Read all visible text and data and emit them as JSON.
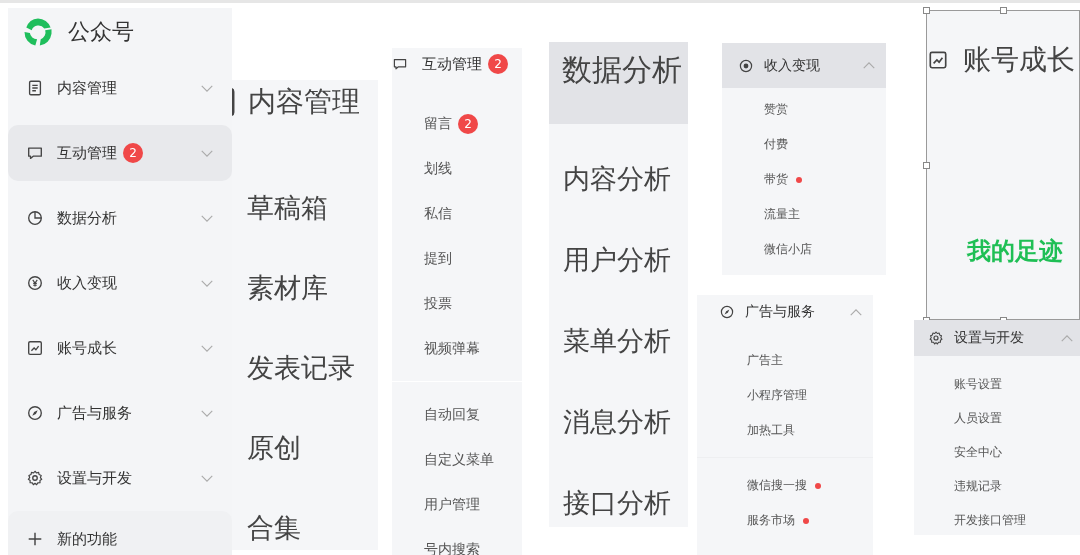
{
  "sidebar": {
    "logo": "公众号",
    "items": [
      {
        "label": "内容管理",
        "selected": false,
        "expanded": false
      },
      {
        "label": "互动管理",
        "badge": "2",
        "selected": true,
        "expanded": false
      },
      {
        "label": "数据分析",
        "selected": false,
        "expanded": false
      },
      {
        "label": "收入变现",
        "selected": false,
        "expanded": false
      },
      {
        "label": "账号成长",
        "selected": false,
        "expanded": false
      },
      {
        "label": "广告与服务",
        "selected": false,
        "expanded": false
      },
      {
        "label": "设置与开发",
        "selected": false,
        "expanded": false
      }
    ],
    "new_feature": "新的功能"
  },
  "panels": [
    {
      "kind": "large",
      "title": "内容管理",
      "highlighted": false,
      "groups": [
        [
          {
            "label": "草稿箱"
          },
          {
            "label": "素材库"
          },
          {
            "label": "发表记录"
          },
          {
            "label": "原创"
          },
          {
            "label": "合集"
          }
        ]
      ]
    },
    {
      "kind": "menu",
      "title": "互动管理",
      "badge": "2",
      "highlighted": false,
      "groups": [
        [
          {
            "label": "留言",
            "badge": "2"
          },
          {
            "label": "划线"
          },
          {
            "label": "私信"
          },
          {
            "label": "提到"
          },
          {
            "label": "投票"
          },
          {
            "label": "视频弹幕"
          }
        ],
        [
          {
            "label": "自动回复"
          },
          {
            "label": "自定义菜单"
          },
          {
            "label": "用户管理"
          },
          {
            "label": "号内搜索"
          }
        ]
      ]
    },
    {
      "kind": "large",
      "title": "数据分析",
      "highlighted": true,
      "groups": [
        [
          {
            "label": "内容分析"
          },
          {
            "label": "用户分析"
          },
          {
            "label": "菜单分析"
          },
          {
            "label": "消息分析"
          },
          {
            "label": "接口分析"
          }
        ]
      ]
    },
    {
      "kind": "menu",
      "title": "收入变现",
      "expanded": true,
      "highlighted": true,
      "groups": [
        [
          {
            "label": "赞赏",
            "dot": false
          },
          {
            "label": "付费",
            "dot": false
          },
          {
            "label": "带货",
            "dot": true
          },
          {
            "label": "流量主",
            "dot": false
          },
          {
            "label": "微信小店",
            "dot": false
          }
        ]
      ]
    },
    {
      "kind": "menu",
      "title": "广告与服务",
      "expanded": true,
      "highlighted": false,
      "groups": [
        [
          {
            "label": "广告主",
            "dot": false
          },
          {
            "label": "小程序管理",
            "dot": false
          },
          {
            "label": "加热工具",
            "dot": false
          }
        ],
        [
          {
            "label": "微信搜一搜",
            "dot": true
          },
          {
            "label": "服务市场",
            "dot": true
          }
        ]
      ]
    },
    {
      "kind": "canvas",
      "title": "账号成长",
      "selected": true,
      "groups": [
        [
          {
            "label": "我的足迹"
          }
        ]
      ]
    },
    {
      "kind": "menu",
      "title": "设置与开发",
      "expanded": true,
      "highlighted": true,
      "groups": [
        [
          {
            "label": "账号设置"
          },
          {
            "label": "人员设置"
          },
          {
            "label": "安全中心"
          },
          {
            "label": "违规记录"
          },
          {
            "label": "开发接口管理"
          }
        ]
      ]
    }
  ]
}
